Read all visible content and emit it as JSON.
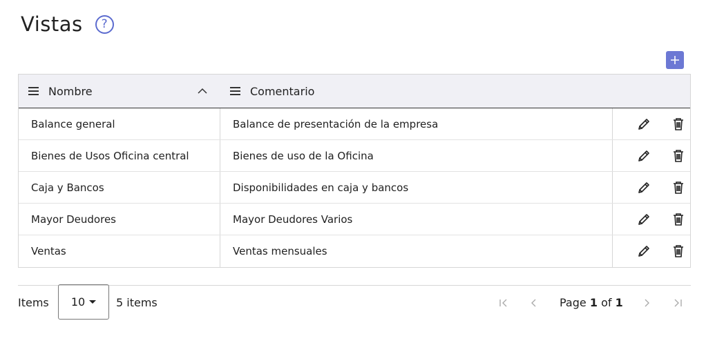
{
  "page": {
    "title": "Vistas",
    "help_glyph": "?"
  },
  "toolbar": {
    "add_icon": "plus-icon"
  },
  "grid": {
    "columns": [
      {
        "label": "Nombre",
        "sort": "ascending"
      },
      {
        "label": "Comentario"
      }
    ],
    "rows": [
      {
        "nombre": "Balance general",
        "comentario": "Balance de presentación de la empresa"
      },
      {
        "nombre": "Bienes de Usos Oficina central",
        "comentario": "Bienes de uso de la Oficina"
      },
      {
        "nombre": "Caja y Bancos",
        "comentario": "Disponibilidades en caja y bancos"
      },
      {
        "nombre": "Mayor Deudores",
        "comentario": "Mayor Deudores Varios"
      },
      {
        "nombre": "Ventas",
        "comentario": "Ventas mensuales"
      }
    ],
    "row_actions": [
      "pencil-icon",
      "trash-icon"
    ]
  },
  "pager": {
    "items_label": "Items",
    "page_size": "10",
    "items_count": "5 items",
    "page_prefix": "Page",
    "current_page": "1",
    "of_label": "of",
    "total_pages": "1"
  },
  "colors": {
    "accent": "#6c78d4",
    "help": "#5b6bcf",
    "header_bg": "#f0f0f5"
  }
}
